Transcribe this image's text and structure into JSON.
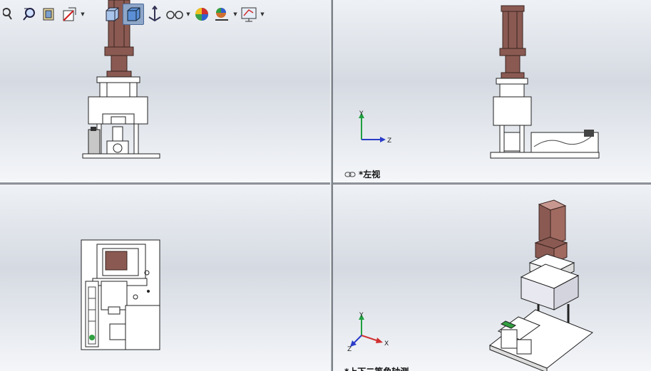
{
  "viewports": {
    "top_left": {
      "name": "front-view"
    },
    "top_right": {
      "name": "left-view",
      "label": "*左视"
    },
    "bottom_left": {
      "name": "top-view"
    },
    "bottom_right": {
      "name": "isometric-view",
      "label": "*上下二等角轴测"
    }
  },
  "toolbar": {
    "icons": [
      "zoom-icon",
      "zoom-area-icon",
      "previous-view-icon",
      "section-view-icon",
      "view-orientation-icon",
      "display-style-icon",
      "hide-show-icon",
      "edit-appearance-icon",
      "apply-scene-icon",
      "view-settings-icon"
    ]
  },
  "triad": {
    "x": "X",
    "y": "Y",
    "z": "Z"
  },
  "colors": {
    "accent": "#8ea6c8",
    "cylinder": "#8a5a52",
    "background_top": "#eef1f5",
    "axis_x": "#d03030",
    "axis_y": "#20a040",
    "axis_z": "#2a3cc8"
  }
}
